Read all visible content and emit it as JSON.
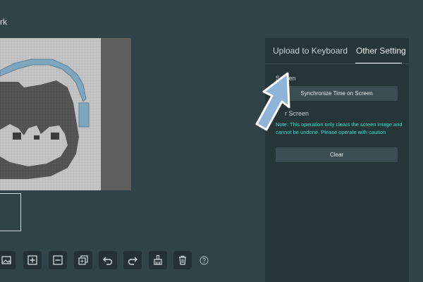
{
  "editor": {
    "title_fragment": "rk",
    "pixel_art_icon": "cat-with-headphones-pixel-art",
    "toolbar": [
      {
        "icon": "image-icon"
      },
      {
        "icon": "add-frame-icon"
      },
      {
        "icon": "remove-frame-icon"
      },
      {
        "icon": "copy-frame-icon"
      },
      {
        "icon": "undo-icon"
      },
      {
        "icon": "redo-icon"
      },
      {
        "icon": "clear-brush-icon"
      },
      {
        "icon": "trash-icon"
      },
      {
        "icon": "help-icon"
      }
    ]
  },
  "panel": {
    "tabs": [
      {
        "label": "Upload to Keyboard",
        "active": false
      },
      {
        "label": "Other Setting",
        "active": true
      }
    ],
    "screen_section": {
      "label": "Screen",
      "sync_button": "Synchronize Time on Screen"
    },
    "clear_section": {
      "label": "r Screen",
      "note": "Note: This operation only clears the screen image and cannot be undone. Please operate with caution",
      "clear_button": "Clear"
    }
  },
  "colors": {
    "background": "#324347",
    "panel": "#263538",
    "button": "#3b4d52",
    "note_text": "#2ee2cf",
    "pointer_arrow": "#8fb3d9",
    "headphones": "#7fa6bf"
  }
}
